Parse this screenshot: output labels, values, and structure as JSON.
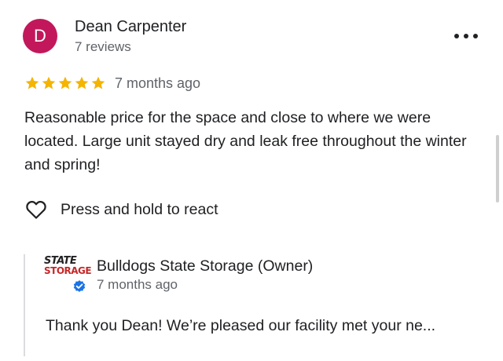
{
  "review": {
    "avatar_initial": "D",
    "avatar_color": "#c2185b",
    "reviewer_name": "Dean Carpenter",
    "reviewer_review_count": "7 reviews",
    "rating": 5,
    "rating_max": 5,
    "star_color": "#f4b400",
    "time_ago": "7 months ago",
    "text": "Reasonable price for the space and close to where we were located. Large unit stayed dry and leak free throughout the winter and spring!",
    "more_icon": "more-horizontal-icon"
  },
  "reaction": {
    "icon": "heart-outline-icon",
    "label": "Press and hold to react"
  },
  "owner_reply": {
    "logo_text_top": "STATE",
    "logo_text_bottom": "STORAGE",
    "owner_name": "Bulldogs State Storage (Owner)",
    "verified_icon": "verified-badge-icon",
    "verified_color": "#1a73e8",
    "time_ago": "7 months ago",
    "text": "Thank you Dean! We’re pleased our facility met your ne..."
  }
}
